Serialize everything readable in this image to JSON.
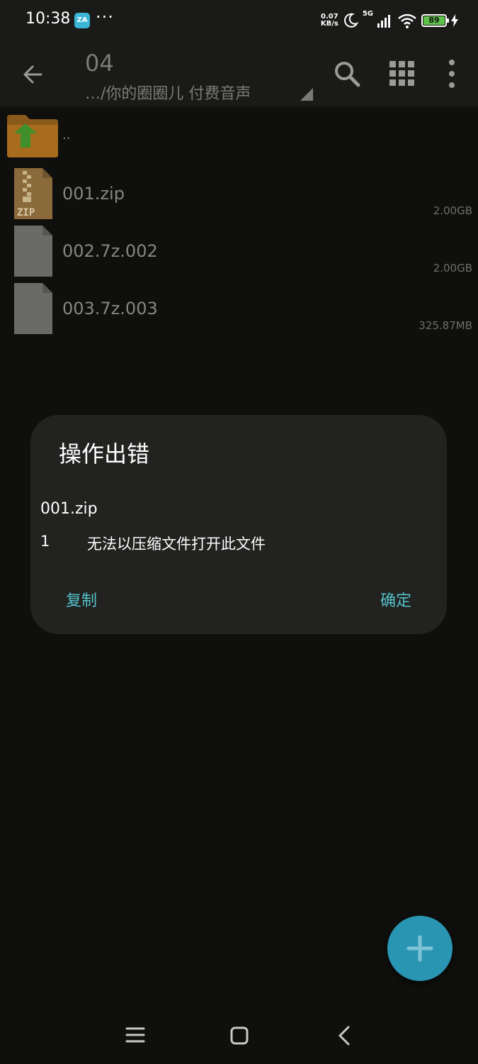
{
  "status_bar": {
    "time": "10:38",
    "app_icon_label": "ZA",
    "more_dots": "···",
    "net_speed_value": "0.07",
    "net_speed_unit": "KB/s",
    "network": "5G",
    "battery_level": "89"
  },
  "toolbar": {
    "title": "04",
    "path": "…/你的圈圈儿 付费音声"
  },
  "files": [
    {
      "name": "..",
      "size": "",
      "icon": "folder-up-icon"
    },
    {
      "name": "001.zip",
      "size": "2.00GB",
      "icon": "zip-file-icon"
    },
    {
      "name": "002.7z.002",
      "size": "2.00GB",
      "icon": "file-icon"
    },
    {
      "name": "003.7z.003",
      "size": "325.87MB",
      "icon": "file-icon"
    }
  ],
  "dialog": {
    "title": "操作出错",
    "file": "001.zip",
    "error_code": "1",
    "error_message": "无法以压缩文件打开此文件",
    "copy_label": "复制",
    "ok_label": "确定"
  },
  "colors": {
    "background": "#0f0f0d",
    "bar": "#1a1a18",
    "dialog": "#222220",
    "accent": "#55c1c9",
    "fab": "#2a95b2"
  }
}
